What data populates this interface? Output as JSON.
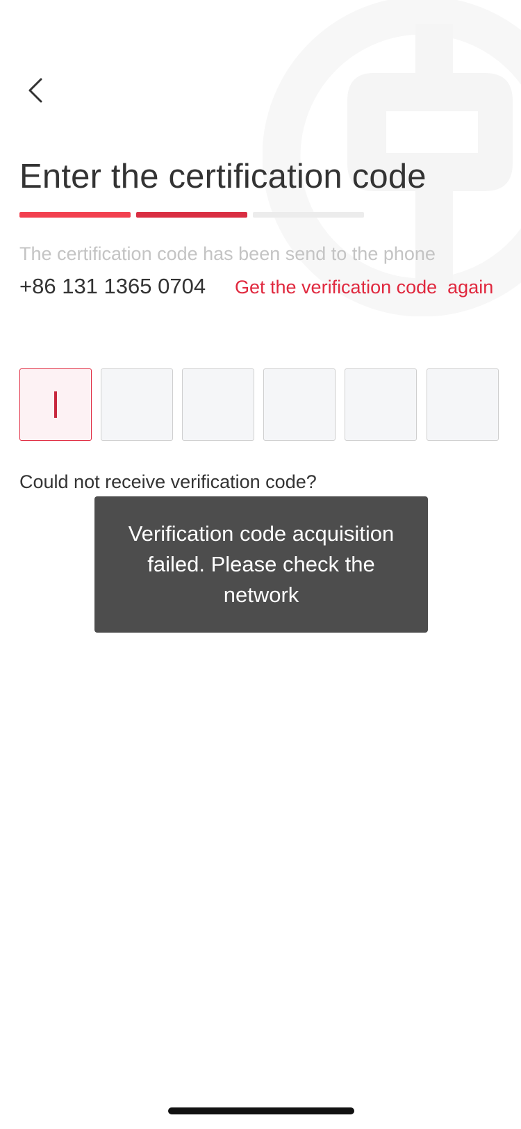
{
  "header": {
    "back_icon": "chevron-left-icon"
  },
  "page": {
    "title": "Enter the certification code",
    "steps": {
      "total": 3,
      "completed": 2,
      "colors": [
        "#f2404f",
        "#d92e42",
        "#ececec"
      ]
    }
  },
  "info": {
    "hint": "The certification code has been send to the phone",
    "phone": "+86 131 1365 0704",
    "resend_label": "Get the verification code  again"
  },
  "code_input": {
    "length": 6,
    "active_index": 0,
    "values": [
      "",
      "",
      "",
      "",
      "",
      ""
    ]
  },
  "help": {
    "no_code_label": "Could not receive verification code?"
  },
  "toast": {
    "message": "Verification code acquisition failed. Please check the network"
  },
  "colors": {
    "accent": "#e0283e",
    "text": "#333333",
    "hint": "#c4c4c4",
    "toast_bg": "#4d4d4d"
  }
}
